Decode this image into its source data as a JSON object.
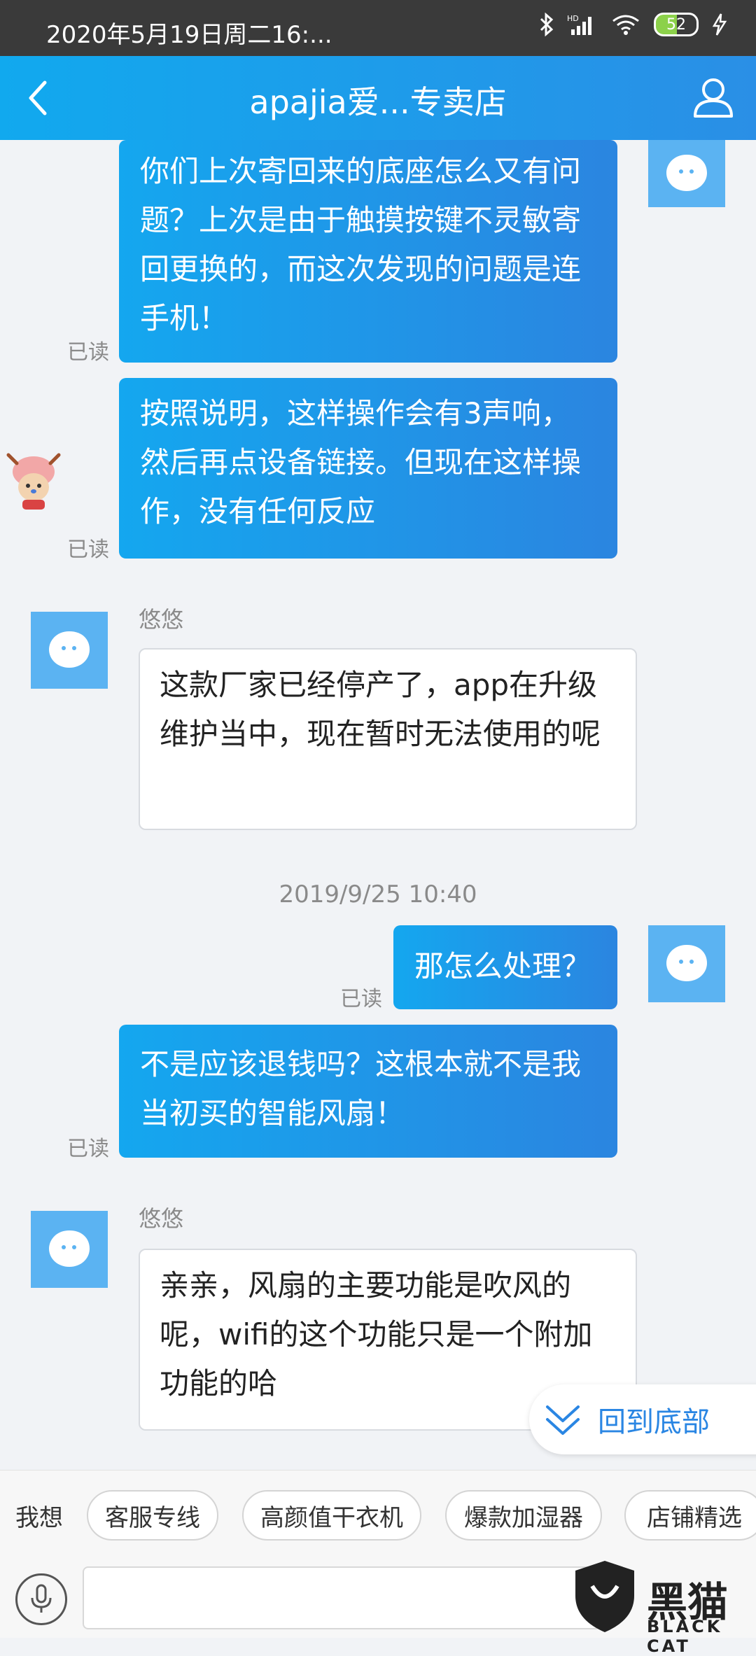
{
  "status_bar": {
    "time": "2020年5月19日周二16:...",
    "icons": [
      "bluetooth-icon",
      "hd-signal-icon",
      "wifi-icon",
      "battery-icon",
      "charging-icon"
    ],
    "battery_level": "52"
  },
  "header": {
    "title": "apajia爱...专卖店",
    "back_icon": "chevron-left-icon",
    "profile_icon": "user-icon"
  },
  "messages": [
    {
      "direction": "out",
      "text": "你们上次寄回来的底座怎么又有问题？上次是由于触摸按键不灵敏寄回更换的，而这次发现的问题是连手机！",
      "status": "已读"
    },
    {
      "direction": "out",
      "text": "按照说明，这样操作会有3声响，然后再点设备链接。但现在这样操作，没有任何反应",
      "status": "已读"
    },
    {
      "direction": "in",
      "sender": "悠悠",
      "text": "这款厂家已经停产了，app在升级维护当中，现在暂时无法使用的呢"
    },
    {
      "type": "timestamp",
      "text": "2019/9/25 10:40"
    },
    {
      "direction": "out",
      "text": "那怎么处理？",
      "status": "已读"
    },
    {
      "direction": "out",
      "text": "不是应该退钱吗？这根本就不是我当初买的智能风扇！",
      "status": "已读"
    },
    {
      "direction": "in",
      "sender": "悠悠",
      "text": "亲亲，风扇的主要功能是吹风的呢，wifi的这个功能只是一个附加功能的哈"
    }
  ],
  "back_to_bottom": "回到底部",
  "quick_bar": {
    "label": "我想",
    "chips": [
      "客服专线",
      "高颜值干衣机",
      "爆款加湿器",
      "店铺精选"
    ]
  },
  "input": {
    "placeholder": ""
  },
  "watermark": {
    "text": "黑猫",
    "sub": "BLACK CAT"
  },
  "colors": {
    "header": "#1aa0ee",
    "bubble_out": "#1e96ea",
    "avatar_bg": "#5bb3f2"
  }
}
